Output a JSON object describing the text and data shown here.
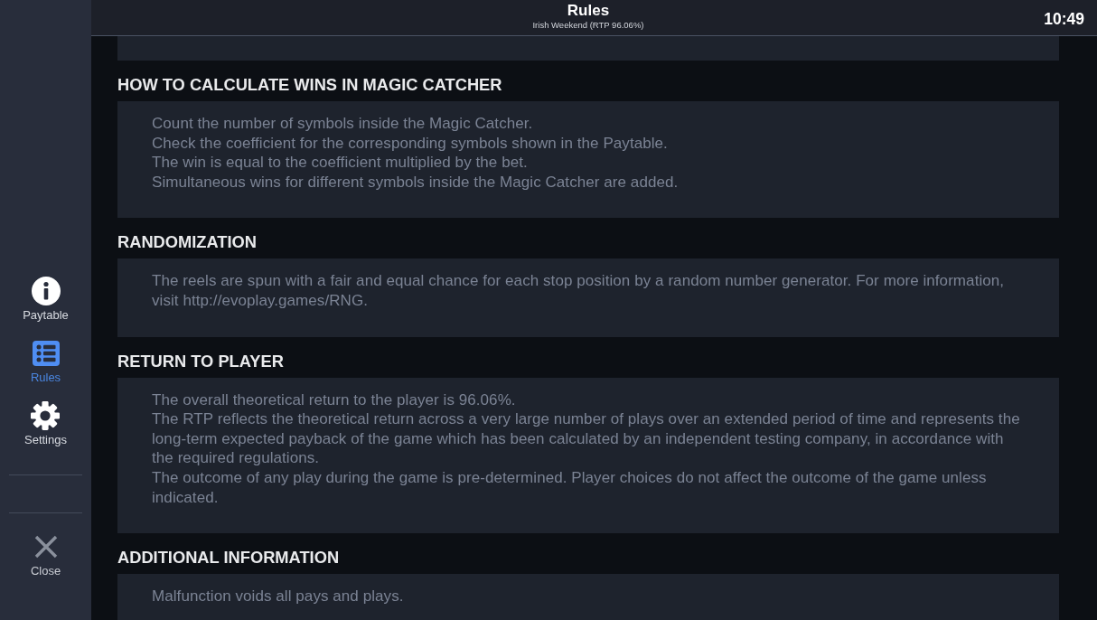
{
  "top_bar": {
    "title": "Rules",
    "subtitle": "Irish Weekend (RTP 96.06%)",
    "time": "10:49"
  },
  "sidebar": {
    "items": [
      {
        "label": "Paytable",
        "selected": false
      },
      {
        "label": "Rules",
        "selected": true
      },
      {
        "label": "Settings",
        "selected": false
      }
    ],
    "close_button": {
      "label": "Close"
    }
  },
  "sections": [
    {
      "heading": "HOW TO CALCULATE WINS IN MAGIC CATCHER",
      "paragraphs": [
        "Count the number of symbols inside the Magic Catcher.",
        "Check the coefficient for the corresponding symbols shown in the Paytable.",
        "The win is equal to the coefficient multiplied by the bet.",
        "Simultaneous wins for different symbols inside the Magic Catcher are added."
      ]
    },
    {
      "heading": "RANDOMIZATION",
      "paragraphs": [
        "The reels are spun with a fair and equal chance for each stop position by a random number generator. For more information, visit http://evoplay.games/RNG."
      ]
    },
    {
      "heading": "RETURN TO PLAYER",
      "paragraphs": [
        "The overall theoretical return to the player is 96.06%.",
        "The RTP reflects the theoretical return across a very large number of plays over an extended period of time and represents the long-term expected payback of the game which has been calculated by an independent testing company, in accordance with the required regulations.",
        "The outcome of any play during the game is pre-determined. Player choices do not affect the outcome of the game unless indicated."
      ]
    },
    {
      "heading": "ADDITIONAL INFORMATION",
      "paragraphs": [
        "Malfunction voids all pays and plays."
      ]
    }
  ]
}
